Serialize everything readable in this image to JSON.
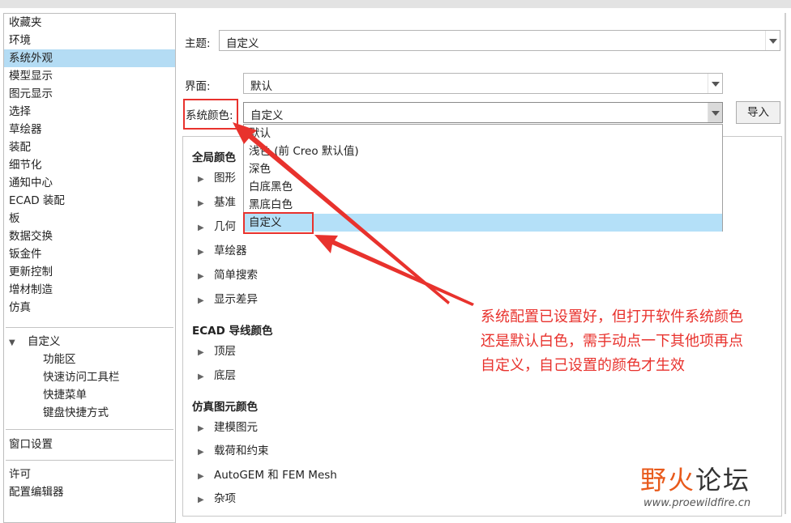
{
  "left_nav": {
    "items": [
      "收藏夹",
      "环境",
      "系统外观",
      "模型显示",
      "图元显示",
      "选择",
      "草绘器",
      "装配",
      "细节化",
      "通知中心",
      "ECAD 装配",
      "板",
      "数据交换",
      "钣金件",
      "更新控制",
      "增材制造",
      "仿真"
    ],
    "selected_index": 2,
    "custom": {
      "label": "自定义",
      "children": [
        "功能区",
        "快速访问工具栏",
        "快捷菜单",
        "键盘快捷方式"
      ]
    },
    "window_settings": "窗口设置",
    "bottom": [
      "许可",
      "配置编辑器"
    ]
  },
  "theme": {
    "label": "主题:",
    "value": "自定义"
  },
  "interface": {
    "label": "界面:",
    "value": "默认"
  },
  "system_colors": {
    "label": "系统颜色:",
    "value": "自定义"
  },
  "import_button": "导入",
  "dropdown": {
    "options": [
      "默认",
      "浅色 (前 Creo 默认值)",
      "深色",
      "白底黑色",
      "黑底白色",
      "自定义"
    ],
    "selected_index": 5
  },
  "panel": {
    "global_colors": {
      "title": "全局颜色",
      "items": [
        "图形",
        "基准",
        "几何",
        "草绘器",
        "简单搜索",
        "显示差异"
      ]
    },
    "ecad_colors": {
      "title": "ECAD 导线颜色",
      "items": [
        "顶层",
        "底层"
      ]
    },
    "sim_colors": {
      "title": "仿真图元颜色",
      "items": [
        "建模图元",
        "载荷和约束",
        "AutoGEM 和 FEM Mesh",
        "杂项"
      ]
    }
  },
  "annotation": {
    "lines": [
      "系统配置已设置好，但打开软件系统颜色",
      "还是默认白色，需手动点一下其他项再点",
      "自定义，自己设置的颜色才生效"
    ],
    "color": "#e8322d"
  },
  "watermark": {
    "part1": "野火",
    "part2": "论坛",
    "url": "www.proewildfire.cn"
  }
}
